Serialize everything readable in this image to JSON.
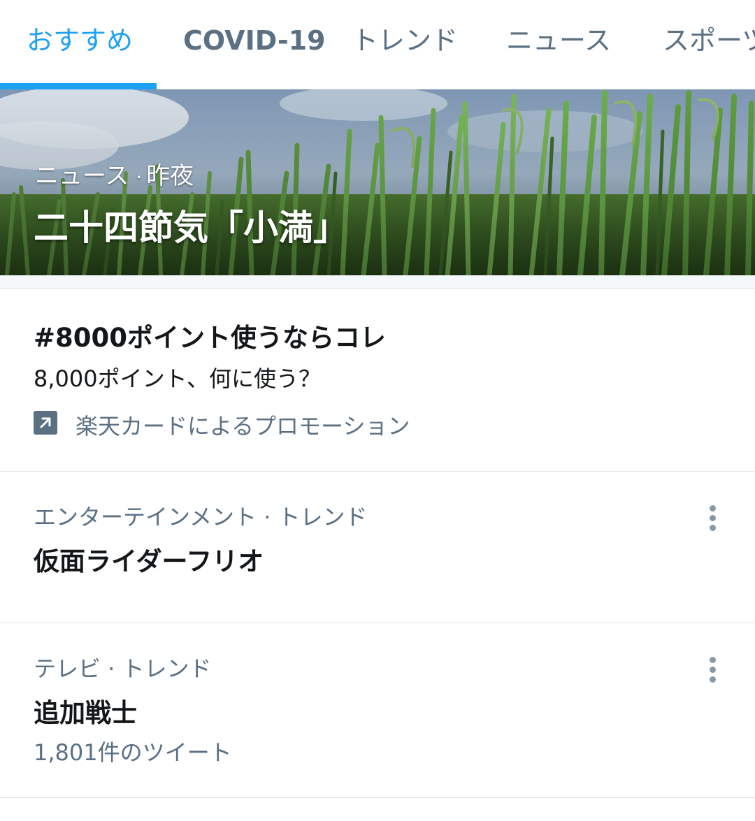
{
  "tabs": [
    {
      "label": "おすすめ",
      "active": true
    },
    {
      "label": "COVID-19",
      "active": false
    },
    {
      "label": "トレンド",
      "active": false
    },
    {
      "label": "ニュース",
      "active": false
    },
    {
      "label": "スポーツ",
      "active": false
    }
  ],
  "hero": {
    "category": "ニュース",
    "separator": "·",
    "time": "昨夜",
    "title": "二十四節気「小満」"
  },
  "trends": [
    {
      "title": "#8000ポイント使うならコレ",
      "description": "8,000ポイント、何に使う？",
      "promo_icon": "promoted-arrow-icon",
      "promoted_by": "楽天カードによるプロモーション"
    },
    {
      "meta": "エンターテインメント · トレンド",
      "title": "仮面ライダーフリオ",
      "menu_icon": "more-vertical-icon"
    },
    {
      "meta": "テレビ · トレンド",
      "title": "追加戦士",
      "tweet_count": "1,801件のツイート",
      "menu_icon": "more-vertical-icon"
    }
  ],
  "colors": {
    "accent": "#1da1f2",
    "secondary_text": "#5b7083",
    "primary_text": "#14171a",
    "divider": "#dde3e8"
  }
}
